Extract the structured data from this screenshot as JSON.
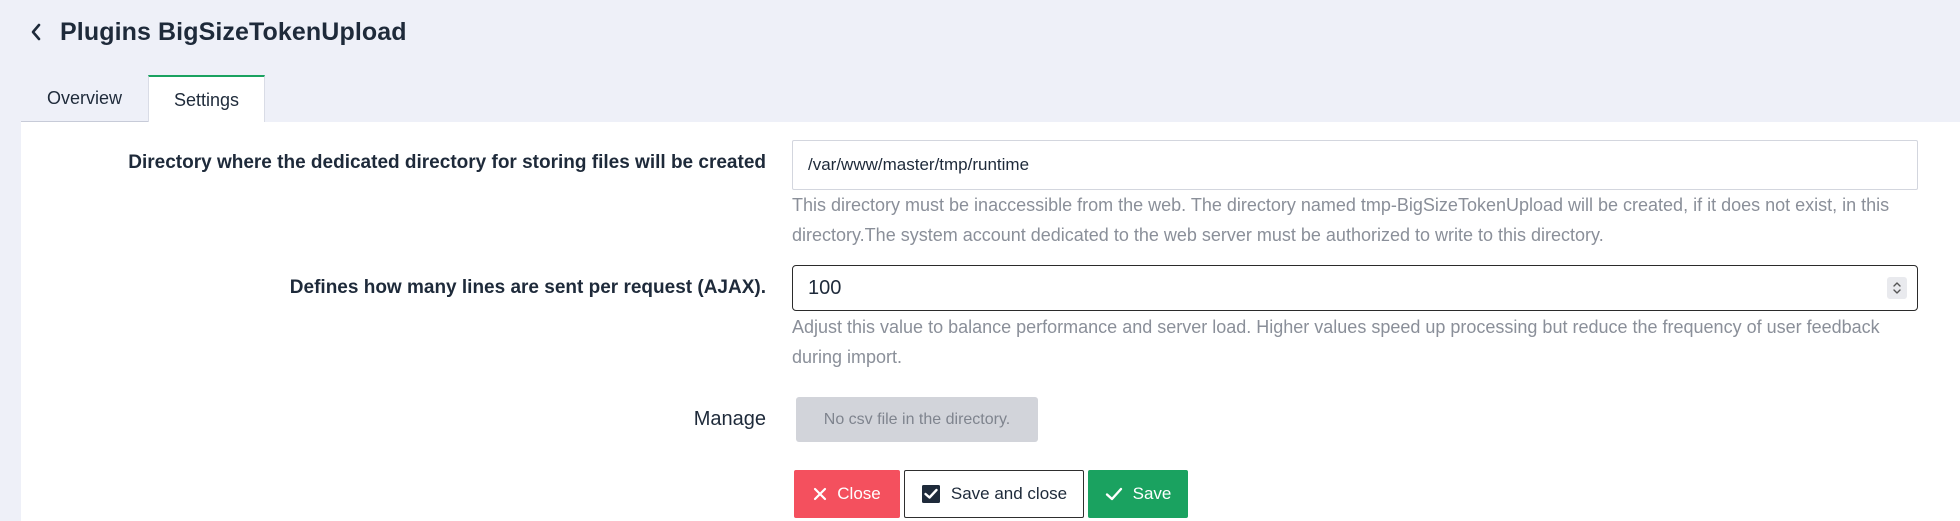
{
  "header": {
    "title": "Plugins BigSizeTokenUpload"
  },
  "tabs": [
    {
      "label": "Overview",
      "active": false
    },
    {
      "label": "Settings",
      "active": true
    }
  ],
  "settings": {
    "directory": {
      "label": "Directory where the dedicated directory for storing files will be created",
      "value": "/var/www/master/tmp/runtime",
      "help": "This directory must be inaccessible from the web. The directory named tmp-BigSizeTokenUpload will be created, if it does not exist, in this directory.The system account dedicated to the web server must be authorized to write to this directory."
    },
    "lines": {
      "label": "Defines how many lines are sent per request (AJAX).",
      "value": "100",
      "help": "Adjust this value to balance performance and server load. Higher values speed up processing but reduce the frequency of user feedback during import."
    },
    "manage": {
      "label": "Manage",
      "button_label": "No csv file in the directory."
    }
  },
  "actions": {
    "close_label": "Close",
    "save_close_label": "Save and close",
    "save_label": "Save"
  },
  "colors": {
    "accent": "#1aa260",
    "danger": "#f4505e",
    "background": "#eef0f8"
  }
}
